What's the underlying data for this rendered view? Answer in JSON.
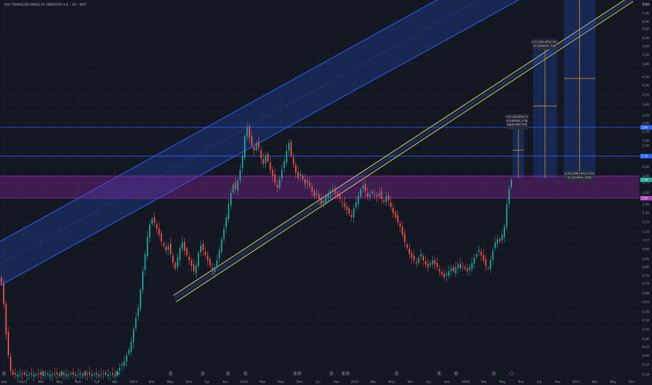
{
  "chart_data": {
    "type": "candlestick",
    "title": "YEO TEKNOLOJİ ENERJİ VE ENDÜSTRİ A.Ş. · 1H · BIST",
    "currency": "USD",
    "y_scale": "log",
    "x_ticks": [
      "Kas",
      "2023",
      "Mar",
      "May",
      "Tem",
      "Eyl",
      "Kas",
      "2023",
      "Mar",
      "May",
      "Tem",
      "Eyl",
      "Kas",
      "2024",
      "Mar",
      "May",
      "Tem",
      "Eyl",
      "Kas",
      "2025",
      "Mar",
      "May",
      "Tem",
      "Eyl",
      "Kas",
      "2026",
      "Mar",
      "May",
      "Tem",
      "Eyl",
      "Kas",
      "2027",
      "Mar",
      "May",
      "Tem"
    ],
    "y_ticks": [
      "8,00",
      "7,40",
      "6,90",
      "6,50",
      "6,00",
      "5,60",
      "5,20",
      "4,80",
      "4,30",
      "4,00",
      "3,70",
      "3,40",
      "3,10",
      "2,90",
      "2,70",
      "2,50",
      "2,40",
      "2,20",
      "2,00",
      "1,85",
      "1,75",
      "1,60",
      "1,45",
      "1,35",
      "1,25",
      "1,15",
      "1,07",
      "0,99",
      "0,91",
      "0,85",
      "0,79",
      "0,74",
      "0,68",
      "0,63",
      "0,58",
      "0,54",
      "0,50",
      "0,46",
      "0,43",
      "0,40",
      "0,37",
      "0,34"
    ],
    "last_price": "1,79",
    "price_badges": [
      {
        "label": "2,80",
        "color": "#2962ff"
      },
      {
        "label": "2,19",
        "color": "#2962ff"
      },
      {
        "label": "1,79",
        "color": "#26a69a"
      },
      {
        "label": "1,53",
        "color": "#ab47bc"
      }
    ],
    "colors": {
      "up": "#26a69a",
      "down": "#ef5350",
      "channel": "#2962ff",
      "trend": "#f0e442",
      "zone": "#9c27b0",
      "projection": "#f5a623"
    },
    "horizontal_levels": [
      2.8,
      2.19
    ],
    "zone": {
      "low": 1.53,
      "high": 1.85
    },
    "annotations": [
      {
        "lines": [
          "0,71 (34,65%) 71",
          "6 çubuklar, 4 5g",
          "Hacim 68,75 M"
        ]
      },
      {
        "lines": [
          "3,27 (161,30%) 327",
          "11 çubuklar, 77g"
        ]
      },
      {
        "lines": [
          "(2,23 (106,74%) 1,223",
          "15 çubuklar, 105g"
        ]
      }
    ],
    "events": [
      "E",
      "E",
      "E",
      "E",
      "E",
      "E",
      "E",
      "E",
      "E",
      "E",
      "E",
      "E",
      "E",
      "E",
      "E",
      "E",
      "E",
      "E"
    ],
    "candles_weekly_close": [
      0.74,
      0.62,
      0.48,
      0.4,
      0.35,
      0.34,
      0.34,
      0.34,
      0.34,
      0.34,
      0.34,
      0.34,
      0.34,
      0.34,
      0.34,
      0.34,
      0.34,
      0.34,
      0.34,
      0.34,
      0.34,
      0.34,
      0.34,
      0.34,
      0.34,
      0.34,
      0.34,
      0.34,
      0.34,
      0.34,
      0.34,
      0.34,
      0.34,
      0.34,
      0.34,
      0.34,
      0.34,
      0.34,
      0.34,
      0.34,
      0.34,
      0.34,
      0.34,
      0.34,
      0.34,
      0.34,
      0.34,
      0.34,
      0.34,
      0.34,
      0.35,
      0.36,
      0.37,
      0.38,
      0.4,
      0.42,
      0.45,
      0.5,
      0.55,
      0.6,
      0.7,
      0.82,
      0.95,
      1.1,
      1.22,
      1.28,
      1.24,
      1.18,
      1.12,
      1.06,
      1.02,
      0.98,
      1.02,
      0.95,
      0.88,
      0.84,
      0.92,
      1.0,
      1.05,
      0.98,
      0.94,
      0.9,
      0.86,
      0.82,
      0.86,
      0.96,
      1.02,
      0.98,
      0.94,
      0.9,
      0.86,
      0.82,
      0.85,
      0.9,
      0.98,
      1.08,
      1.18,
      1.3,
      1.45,
      1.6,
      1.72,
      1.65,
      1.78,
      1.95,
      2.2,
      2.6,
      2.8,
      2.55,
      2.4,
      2.3,
      2.45,
      2.35,
      2.15,
      2.05,
      2.2,
      2.1,
      1.95,
      1.85,
      1.75,
      1.68,
      1.8,
      1.95,
      2.1,
      2.3,
      2.45,
      2.2,
      2.05,
      1.9,
      1.82,
      1.88,
      1.8,
      1.72,
      1.78,
      1.7,
      1.62,
      1.55,
      1.6,
      1.52,
      1.45,
      1.5,
      1.55,
      1.58,
      1.62,
      1.66,
      1.6,
      1.55,
      1.52,
      1.48,
      1.42,
      1.38,
      1.34,
      1.3,
      1.4,
      1.48,
      1.56,
      1.65,
      1.7,
      1.62,
      1.55,
      1.58,
      1.62,
      1.58,
      1.55,
      1.6,
      1.52,
      1.48,
      1.55,
      1.5,
      1.42,
      1.35,
      1.3,
      1.25,
      1.2,
      1.12,
      1.05,
      1.0,
      0.95,
      0.92,
      0.9,
      0.88,
      0.92,
      0.95,
      0.9,
      0.87,
      0.85,
      0.88,
      0.9,
      0.87,
      0.85,
      0.82,
      0.8,
      0.78,
      0.8,
      0.82,
      0.84,
      0.82,
      0.85,
      0.87,
      0.84,
      0.86,
      0.84,
      0.82,
      0.85,
      0.88,
      0.92,
      0.95,
      0.98,
      0.94,
      0.9,
      0.86,
      0.84,
      0.9,
      0.98,
      1.05,
      1.08,
      1.06,
      1.12,
      1.2,
      1.45,
      1.65,
      1.79
    ]
  }
}
